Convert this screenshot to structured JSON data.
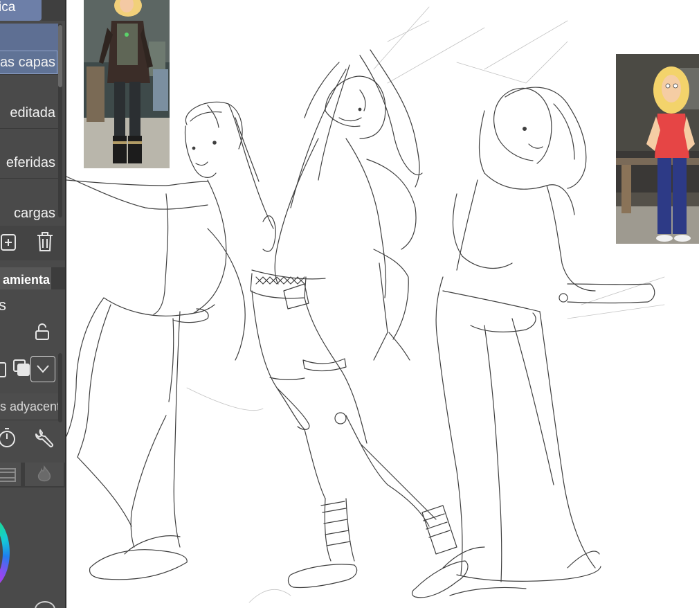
{
  "side_panel": {
    "top_tab": "ica",
    "layer_list": [
      {
        "label": "as capas",
        "selected": true
      },
      {
        "label": "editada",
        "selected": false
      },
      {
        "label": "eferidas",
        "selected": false
      },
      {
        "label": "cargas",
        "selected": false
      }
    ],
    "layer_actions": [
      {
        "icon": "new-layer-icon"
      },
      {
        "icon": "trash-icon"
      }
    ],
    "tool_section": {
      "header": "amienta",
      "stub_text": "s",
      "lock_icon": "unlock-icon",
      "mode_icons": [
        "copy-layer-icon",
        "merge-layers-icon",
        "chevron-down-icon"
      ],
      "adjacent_field": "s adyacente",
      "tool_icons": [
        "timer-icon",
        "wrench-icon"
      ]
    },
    "bottom_tabs": [
      "film-icon",
      "flame-icon"
    ],
    "color_wheel": "color-wheel"
  },
  "canvas": {
    "reference_images": [
      {
        "name": "reference-image-1",
        "subject": "character in dark armored outfit"
      },
      {
        "name": "reference-image-2",
        "subject": "character with blonde hair, red shirt, blue pants"
      }
    ],
    "sketch": "pencil-sketch-three-figures"
  },
  "colors": {
    "panel_bg": "#4a4a4a",
    "selection_blue": "#5e6f93",
    "canvas_bg": "#ffffff",
    "ink": "#1e1e1e"
  }
}
